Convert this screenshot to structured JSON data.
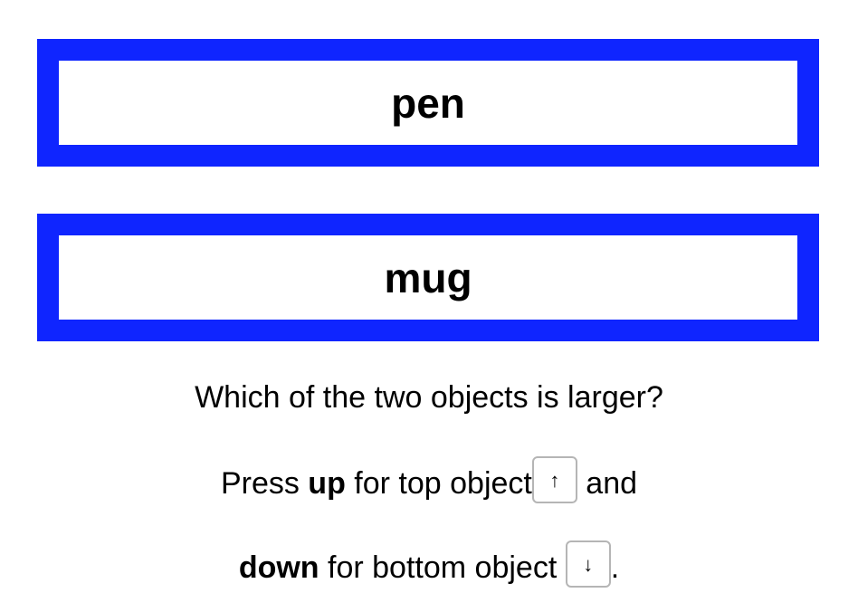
{
  "options": {
    "top": "pen",
    "bottom": "mug"
  },
  "question": "Which of the two objects is larger?",
  "instructions": {
    "line1_prefix": "Press ",
    "line1_bold": "up",
    "line1_middle": " for top object",
    "up_key": "↑",
    "line1_suffix": " and",
    "line2_bold": "down",
    "line2_middle": " for bottom object ",
    "down_key": "↓",
    "line2_suffix": "."
  },
  "colors": {
    "box_border": "#0f25ff",
    "key_border": "#b5b5b5"
  }
}
